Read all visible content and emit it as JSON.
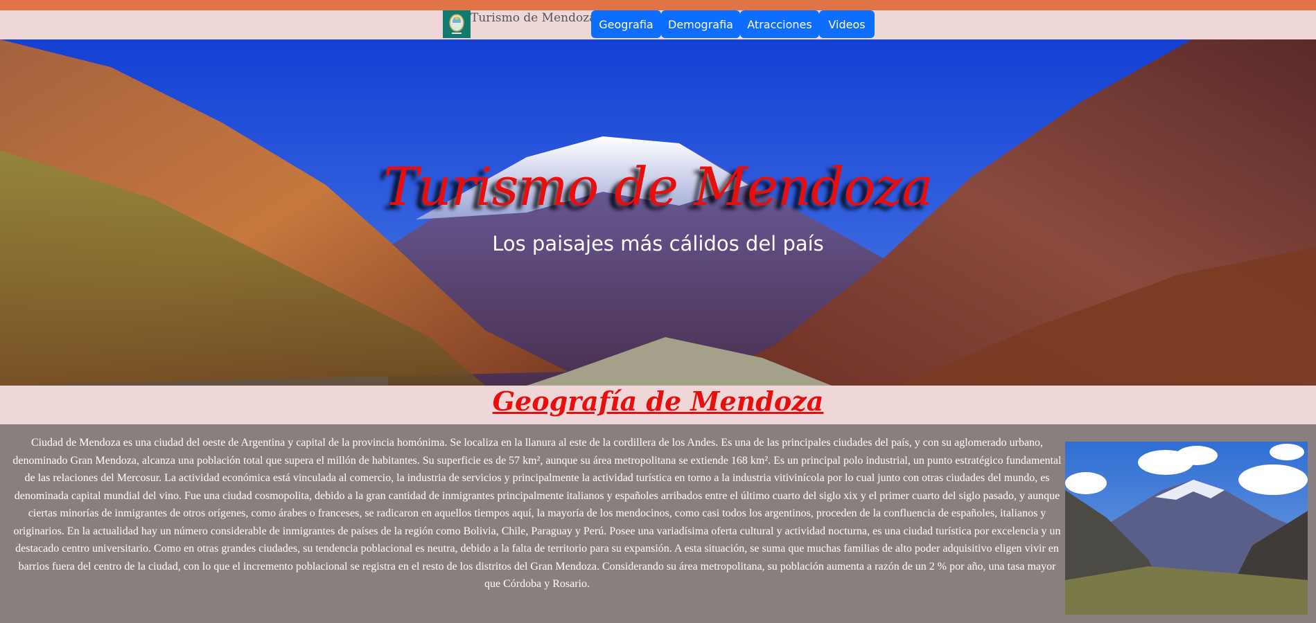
{
  "brand": {
    "name": "Turismo de Mendoza",
    "logo_icon": "mendoza-coat-of-arms-icon"
  },
  "nav": {
    "items": [
      {
        "label": "Geografia"
      },
      {
        "label": "Demografia"
      },
      {
        "label": "Atracciones"
      },
      {
        "label": "Videos"
      }
    ]
  },
  "hero": {
    "title": "Turismo de Mendoza",
    "subtitle": "Los paisajes más cálidos del país"
  },
  "section": {
    "title": "Geografía de Mendoza",
    "paragraph": "Ciudad de Mendoza es una ciudad del oeste de Argentina y capital de la provincia homónima. Se localiza en la llanura al este de la cordillera de los Andes. Es una de las principales ciudades del país, y con su aglomerado urbano, denominado Gran Mendoza, alcanza una población total que supera el millón de habitantes. Su superficie es de 57 km², aunque su área metropolitana se extiende 168 km². Es un principal polo industrial, un punto estratégico fundamental de las relaciones del Mercosur. La actividad económica está vinculada al comercio, la industria de servicios y principalmente la actividad turística en torno a la industria vitivinícola por lo cual junto con otras ciudades del mundo, es denominada capital mundial del vino. Fue una ciudad cosmopolita, debido a la gran cantidad de inmigrantes principalmente italianos y españoles arribados entre el último cuarto del siglo xix y el primer cuarto del siglo pasado, y aunque ciertas minorías de inmigrantes de otros orígenes, como árabes o franceses, se radicaron en aquellos tiempos aquí, la mayoría de los mendocinos, como casi todos los argentinos, proceden de la confluencia de españoles, italianos y originarios. En la actualidad hay un número considerable de inmigrantes de países de la región como Bolivia, Chile, Paraguay y Perú. Posee una variadísima oferta cultural y actividad nocturna, es una ciudad turística por excelencia y un destacado centro universitario. Como en otras grandes ciudades, su tendencia poblacional es neutra, debido a la falta de territorio para su expansión. A esta situación, se suma que muchas familias de alto poder adquisitivo eligen vivir en barrios fuera del centro de la ciudad, con lo que el incremento poblacional se registra en el resto de los distritos del Gran Mendoza. Considerando su área metropolitana, su población aumenta a razón de un 2 % por año, una tasa mayor que Córdoba y Rosario."
  },
  "colors": {
    "accent_bar": "#e07446",
    "page_bg": "#efd7d7",
    "nav_button": "#0d6efd",
    "title_red": "#e80e0e",
    "content_bg": "#8a7f7f"
  }
}
